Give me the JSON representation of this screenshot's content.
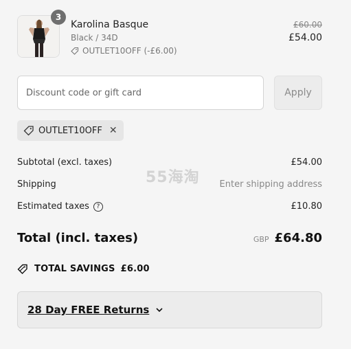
{
  "product": {
    "quantity": "3",
    "title": "Karolina Basque",
    "variant": "Black / 34D",
    "discount_line": "OUTLET10OFF (-£6.00)",
    "original_price": "£60.00",
    "price": "£54.00"
  },
  "discount": {
    "placeholder": "Discount code or gift card",
    "apply_label": "Apply",
    "applied_code": "OUTLET10OFF"
  },
  "summary": {
    "subtotal_label": "Subtotal (excl. taxes)",
    "subtotal_value": "£54.00",
    "shipping_label": "Shipping",
    "shipping_value": "Enter shipping address",
    "taxes_label": "Estimated taxes",
    "taxes_value": "£10.80",
    "total_label": "Total (incl. taxes)",
    "total_currency": "GBP",
    "total_value": "£64.80"
  },
  "savings": {
    "label": "TOTAL SAVINGS",
    "value": "£6.00"
  },
  "returns": {
    "label": "28 Day FREE Returns"
  },
  "watermark": "55海淘"
}
